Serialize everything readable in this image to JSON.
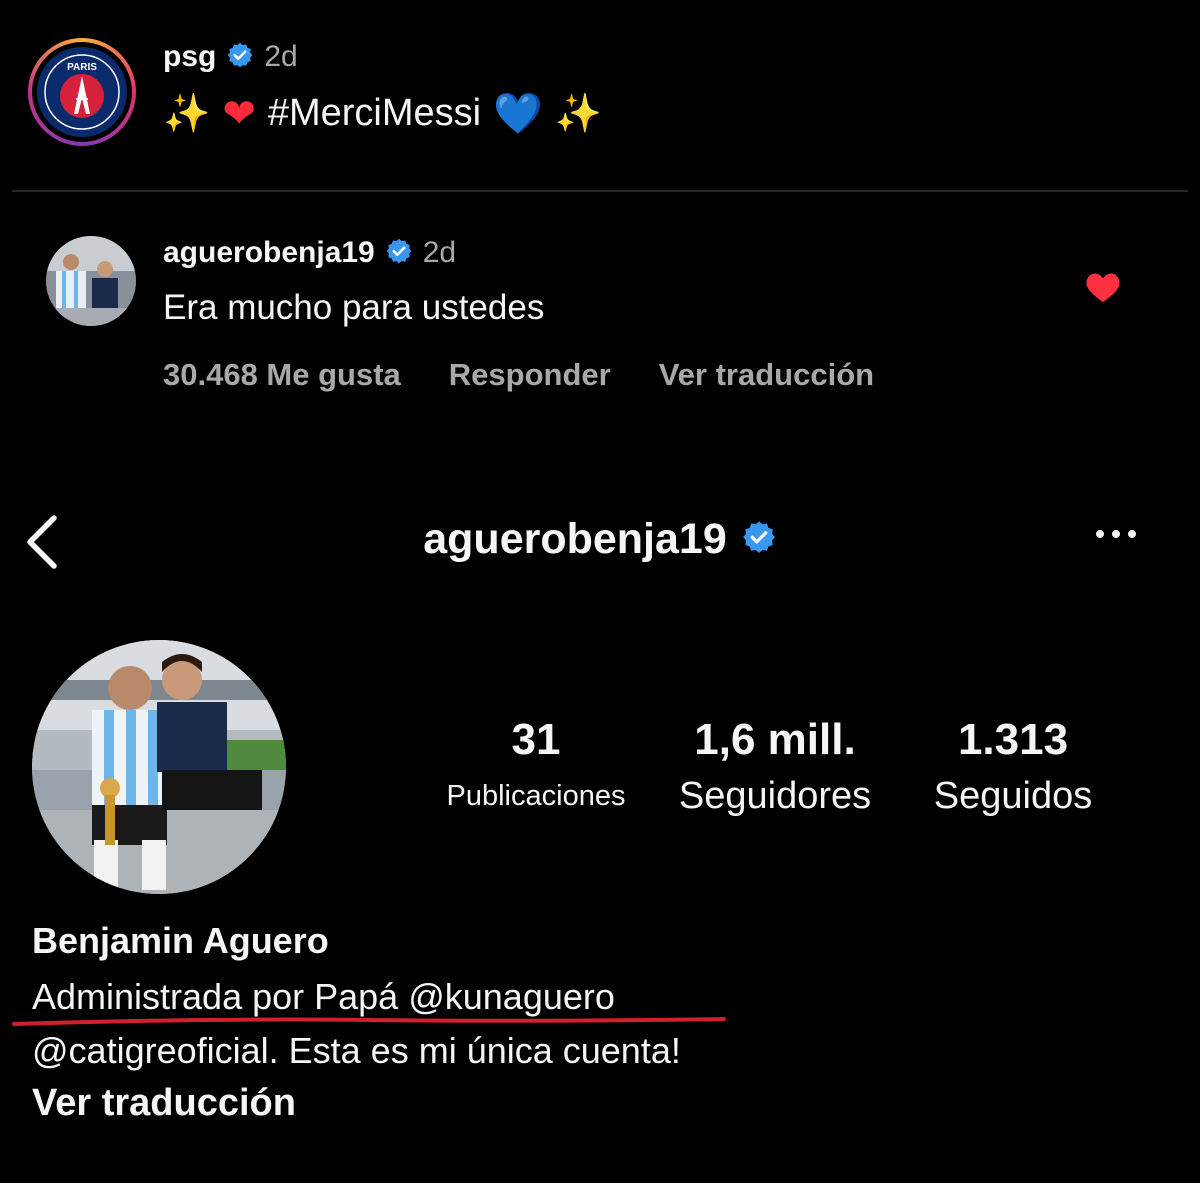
{
  "post": {
    "username": "psg",
    "time": "2d",
    "caption_emojis_left": [
      "✨",
      "❤"
    ],
    "caption_text": "#MerciMessi",
    "caption_emojis_right": [
      "💙",
      "✨"
    ],
    "avatar_logo_text": "PARIS"
  },
  "comment": {
    "username": "aguerobenja19",
    "time": "2d",
    "text": "Era mucho para ustedes",
    "likes": "30.468 Me gusta",
    "reply_label": "Responder",
    "translate_label": "Ver traducción",
    "liked": true
  },
  "profile": {
    "username": "aguerobenja19",
    "stats": [
      {
        "value": "31",
        "label": "Publicaciones"
      },
      {
        "value": "1,6 mill.",
        "label": "Seguidores"
      },
      {
        "value": "1.313",
        "label": "Seguidos"
      }
    ],
    "name": "Benjamin Aguero",
    "bio_line1": "Administrada por Papá @kunaguero",
    "bio_line2": "@catigreoficial. Esta es mi única cuenta!",
    "translate_label": "Ver traducción"
  },
  "colors": {
    "background": "#000000",
    "verified": "#3897f0",
    "like_heart": "#ff3040",
    "underline": "#d0202a",
    "muted_text": "#a8a8a8"
  },
  "icons": [
    "verified-badge-icon",
    "heart-icon",
    "back-chevron-icon",
    "more-options-icon"
  ]
}
